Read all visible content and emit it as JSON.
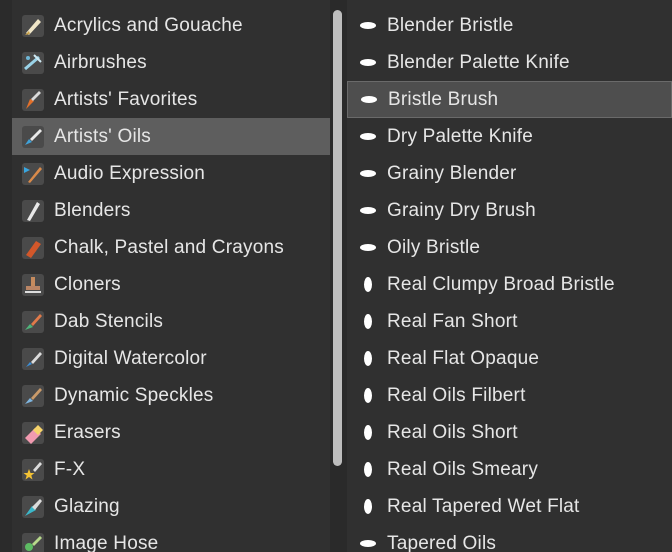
{
  "categories": [
    {
      "label": "Acrylics and Gouache",
      "icon": "acrylic-brush-icon"
    },
    {
      "label": "Airbrushes",
      "icon": "airbrush-icon"
    },
    {
      "label": "Artists' Favorites",
      "icon": "favorites-brush-icon"
    },
    {
      "label": "Artists' Oils",
      "icon": "oils-brush-icon",
      "selected": true
    },
    {
      "label": "Audio Expression",
      "icon": "audio-brush-icon"
    },
    {
      "label": "Blenders",
      "icon": "blender-brush-icon"
    },
    {
      "label": "Chalk, Pastel and Crayons",
      "icon": "chalk-icon"
    },
    {
      "label": "Cloners",
      "icon": "cloner-stamp-icon"
    },
    {
      "label": "Dab Stencils",
      "icon": "dab-stencil-icon"
    },
    {
      "label": "Digital Watercolor",
      "icon": "watercolor-brush-icon"
    },
    {
      "label": "Dynamic Speckles",
      "icon": "speckles-brush-icon"
    },
    {
      "label": "Erasers",
      "icon": "eraser-icon"
    },
    {
      "label": "F-X",
      "icon": "fx-star-icon"
    },
    {
      "label": "Glazing",
      "icon": "glazing-brush-icon"
    },
    {
      "label": "Image Hose",
      "icon": "image-hose-icon"
    }
  ],
  "variants": [
    {
      "label": "Blender Bristle",
      "dab": "flat"
    },
    {
      "label": "Blender Palette Knife",
      "dab": "flat"
    },
    {
      "label": "Bristle Brush",
      "dab": "flat",
      "selected": true
    },
    {
      "label": "Dry Palette Knife",
      "dab": "flat"
    },
    {
      "label": "Grainy Blender",
      "dab": "flat"
    },
    {
      "label": "Grainy Dry Brush",
      "dab": "flat"
    },
    {
      "label": "Oily Bristle",
      "dab": "flat"
    },
    {
      "label": "Real Clumpy Broad Bristle",
      "dab": "round"
    },
    {
      "label": "Real Fan Short",
      "dab": "round"
    },
    {
      "label": "Real Flat Opaque",
      "dab": "round"
    },
    {
      "label": "Real Oils Filbert",
      "dab": "round"
    },
    {
      "label": "Real Oils Short",
      "dab": "round"
    },
    {
      "label": "Real Oils Smeary",
      "dab": "round"
    },
    {
      "label": "Real Tapered Wet Flat",
      "dab": "round"
    },
    {
      "label": "Tapered Oils",
      "dab": "flat"
    }
  ]
}
